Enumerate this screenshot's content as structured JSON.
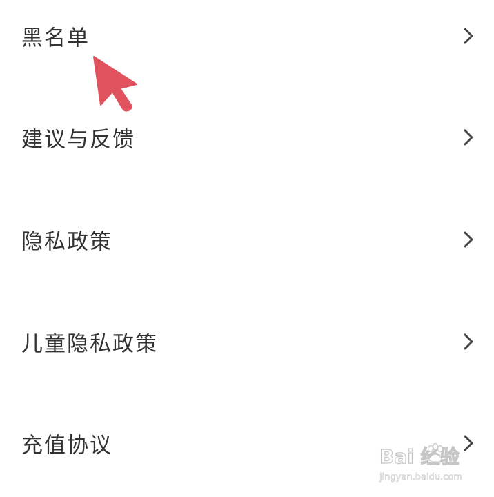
{
  "menu": {
    "items": [
      {
        "label": "黑名单",
        "icon": "chevron-right-icon"
      },
      {
        "label": "建议与反馈",
        "icon": "chevron-right-icon"
      },
      {
        "label": "隐私政策",
        "icon": "chevron-right-icon"
      },
      {
        "label": "儿童隐私政策",
        "icon": "chevron-right-icon"
      },
      {
        "label": "充值协议",
        "icon": "chevron-right-icon"
      }
    ]
  },
  "annotation": {
    "icon": "pointer-arrow-icon",
    "color": "#e0525e"
  },
  "watermark": {
    "logo_text": "Bai  经验",
    "url": "jingyan.baidu.com"
  },
  "colors": {
    "text": "#333333",
    "chevron": "#444444",
    "background": "#ffffff"
  }
}
